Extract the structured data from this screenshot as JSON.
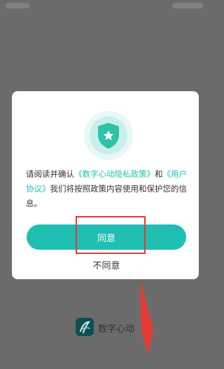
{
  "dialog": {
    "policy_intro": "请阅读并确认",
    "privacy_link": "《数字心动隐私政策》",
    "conjunction": "和",
    "user_agreement_link": "《用户协议》",
    "policy_outro": "我们将按照政策内容使用和保护您的信息。",
    "agree_label": "同意",
    "disagree_label": "不同意"
  },
  "brand": {
    "name": "数字心动"
  },
  "colors": {
    "accent": "#1fbfb3",
    "backdrop": "#6b6b6b",
    "annotation": "#e53935"
  }
}
